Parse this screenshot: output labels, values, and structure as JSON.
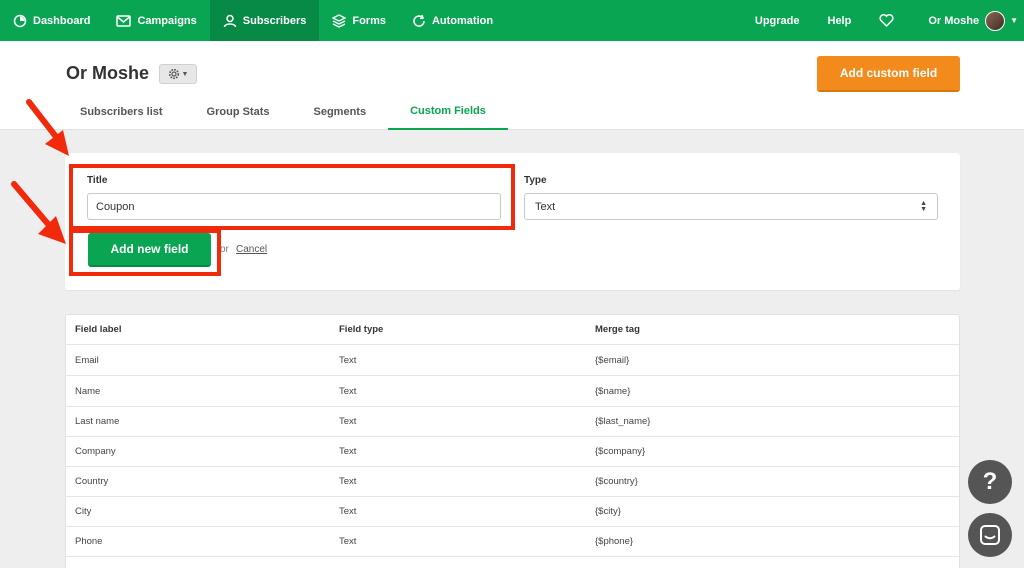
{
  "nav": {
    "items": [
      {
        "label": "Dashboard",
        "icon": "dashboard-icon"
      },
      {
        "label": "Campaigns",
        "icon": "mail-icon"
      },
      {
        "label": "Subscribers",
        "icon": "user-icon"
      },
      {
        "label": "Forms",
        "icon": "layers-icon"
      },
      {
        "label": "Automation",
        "icon": "refresh-icon"
      }
    ],
    "upgrade": "Upgrade",
    "help": "Help",
    "user_name": "Or Moshe"
  },
  "header": {
    "title": "Or Moshe",
    "add_custom_field": "Add custom field",
    "tabs": [
      "Subscribers list",
      "Group Stats",
      "Segments",
      "Custom Fields"
    ],
    "active_tab": "Custom Fields"
  },
  "form": {
    "title_label": "Title",
    "title_value": "Coupon",
    "type_label": "Type",
    "type_value": "Text",
    "add_button": "Add new field",
    "or": "or",
    "cancel": "Cancel"
  },
  "table": {
    "headers": [
      "Field label",
      "Field type",
      "Merge tag"
    ],
    "rows": [
      [
        "Email",
        "Text",
        "{$email}"
      ],
      [
        "Name",
        "Text",
        "{$name}"
      ],
      [
        "Last name",
        "Text",
        "{$last_name}"
      ],
      [
        "Company",
        "Text",
        "{$company}"
      ],
      [
        "Country",
        "Text",
        "{$country}"
      ],
      [
        "City",
        "Text",
        "{$city}"
      ],
      [
        "Phone",
        "Text",
        "{$phone}"
      ],
      [
        "",
        "",
        ""
      ]
    ]
  },
  "colors": {
    "brand_green": "#09a552",
    "orange": "#f28b1c",
    "highlight_red": "#f22a0c"
  },
  "fab": {
    "help": "?"
  }
}
